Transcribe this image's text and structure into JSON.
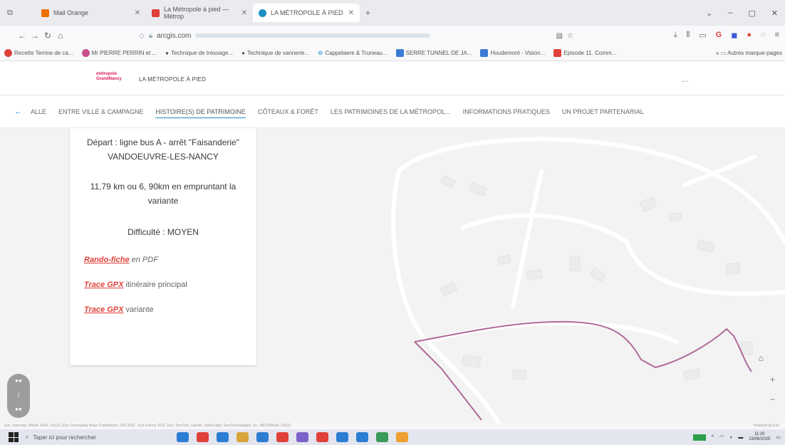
{
  "browser": {
    "tabs": [
      {
        "label": "Mail Orange",
        "color": "#f16e00"
      },
      {
        "label": "La Métropole à pied — Métrop",
        "color": "#e0413b"
      },
      {
        "label": "LA MÉTROPOLE À PIED",
        "color": "#1b8fc4"
      }
    ],
    "url": {
      "host": "arcgis.com",
      "secure_icon": "lock-icon"
    },
    "bookmarks": [
      {
        "label": "Recette Terrine de ca...",
        "color": "#e0413b"
      },
      {
        "label": "Mr PIERRE PERRIN et ...",
        "color": "#c94f8a"
      },
      {
        "label": "Technique de tressage...",
        "color": "#888888"
      },
      {
        "label": "Technique de vannerie...",
        "color": "#888888"
      },
      {
        "label": "Cappelaere & Truneau...",
        "color": "#1b8fc4"
      },
      {
        "label": "SERRE TUNNEL DE JA...",
        "color": "#3b7bd6"
      },
      {
        "label": "Houdemont - Vision...",
        "color": "#3b7bd6"
      },
      {
        "label": "Episode 11. Comm...",
        "color": "#e0413b"
      }
    ],
    "bookmarks_more": "Autres marque-pages"
  },
  "site": {
    "logo_lines": [
      "métropole",
      "GrandNancy"
    ],
    "title": "LA MÉTROPOLE À PIED",
    "more": "..."
  },
  "menu": {
    "back": "←",
    "items": [
      {
        "label": "ALLE",
        "active": false
      },
      {
        "label": "ENTRE VILLE & CAMPAGNE",
        "active": false
      },
      {
        "label": "HISTOIRE(S) DE PATRIMOINE",
        "active": true
      },
      {
        "label": "CÔTEAUX & FORÊT",
        "active": false
      },
      {
        "label": "LES PATRIMOINES DE LA MÉTROPOL...",
        "active": false
      },
      {
        "label": "INFORMATIONS PRATIQUES",
        "active": false
      },
      {
        "label": "UN PROJET PARTENARIAL",
        "active": false
      }
    ]
  },
  "panel": {
    "depart": "Départ : ligne bus A - arrêt \"Faisanderie\" VANDOEUVRE-LES-NANCY",
    "distance": "11,79 km ou 6, 90km en empruntant la variante",
    "difficulty": "Difficulté : MOYEN",
    "links": [
      {
        "link": "Rando-fiche",
        "suffix": " en PDF"
      },
      {
        "link": "Trace GPX",
        "suffix": " itinéraire principal"
      },
      {
        "link": "Trace GPX",
        "suffix": " variante"
      }
    ]
  },
  "map": {
    "route_color": "#b06a9a",
    "attribution": "Esri, Intermap, NASA, NGA, USGS | Esri Community Maps Contributors, GIS 2022 , Esri France 2022, Esri, TomTom, Garmin, SafeGraph, GeoTechnologies, Inc, METI/NASA, USGS",
    "powered": "Powered by Esri"
  },
  "taskbar": {
    "search_placeholder": "Taper ici pour rechercher",
    "time": "11:20",
    "date": "23/06/2025",
    "icon_colors": [
      "#2d7dd2",
      "#e0413b",
      "#2d7dd2",
      "#d9a43b",
      "#2d7dd2",
      "#e0413b",
      "#7b61c9",
      "#e0413b",
      "#2d7dd2",
      "#2d7dd2",
      "#3a9a5a",
      "#f0a030"
    ]
  }
}
